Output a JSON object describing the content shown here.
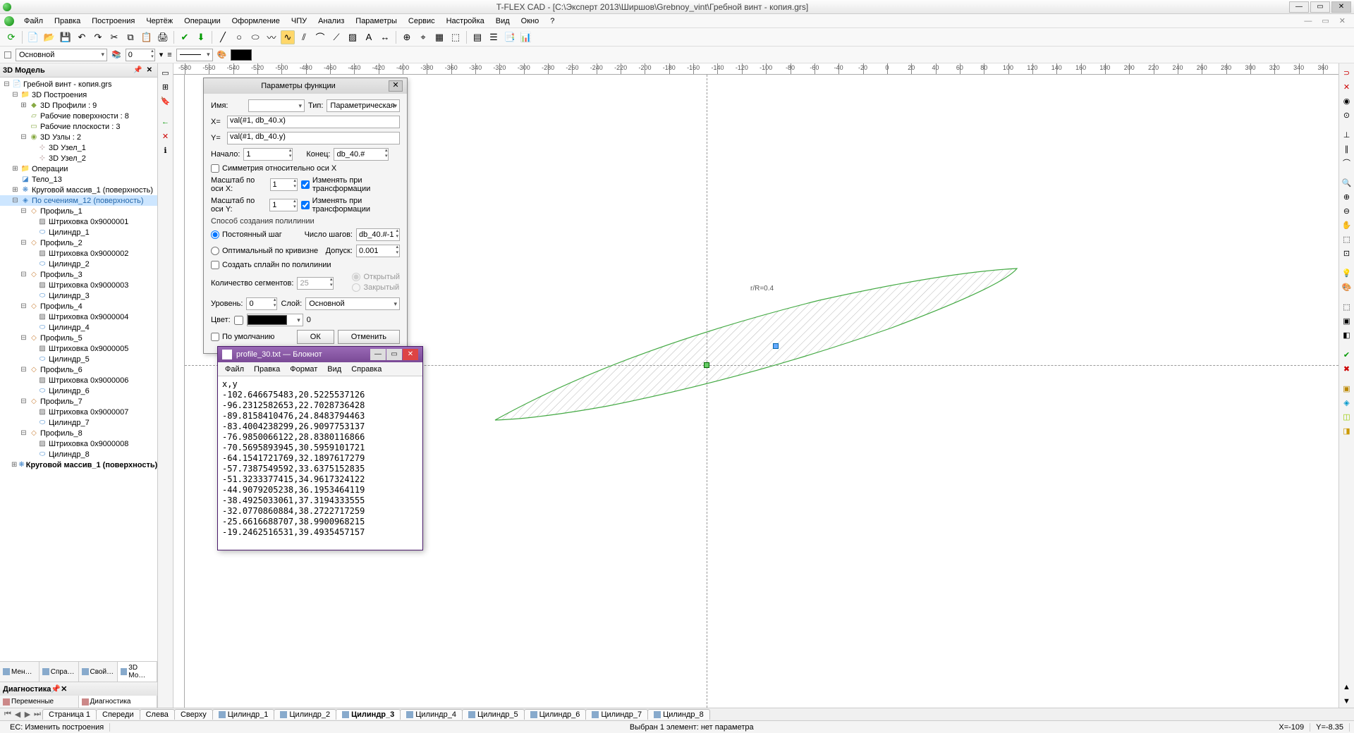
{
  "app": {
    "title": "T-FLEX CAD - [C:\\Эксперт 2013\\Ширшов\\Grebnoy_vint\\Гребной винт - копия.grs]"
  },
  "menu": [
    "Файл",
    "Правка",
    "Построения",
    "Чертёж",
    "Операции",
    "Оформление",
    "ЧПУ",
    "Анализ",
    "Параметры",
    "Сервис",
    "Настройка",
    "Вид",
    "Окно",
    "?"
  ],
  "props": {
    "layer": "Основной",
    "level": "0",
    "color_field": ""
  },
  "left_panel": {
    "title": "3D Модель",
    "root": "Гребной винт - копия.grs",
    "grp_3d": "3D Построения",
    "profiles": "3D Профили : 9",
    "surfaces": "Рабочие поверхности : 8",
    "planes": "Рабочие плоскости : 3",
    "nodes": "3D Узлы : 2",
    "node1": "3D Узел_1",
    "node2": "3D Узел_2",
    "ops": "Операции",
    "body": "Тело_13",
    "circ": "Круговой массив_1 (поверхность)",
    "loft": "По сечениям_12 (поверхность)",
    "p1": "Профиль_1",
    "h1": "Штриховка 0x9000001",
    "c1": "Цилиндр_1",
    "p2": "Профиль_2",
    "h2": "Штриховка 0x9000002",
    "c2": "Цилиндр_2",
    "p3": "Профиль_3",
    "h3": "Штриховка 0x9000003",
    "c3": "Цилиндр_3",
    "p4": "Профиль_4",
    "h4": "Штриховка 0x9000004",
    "c4": "Цилиндр_4",
    "p5": "Профиль_5",
    "h5": "Штриховка 0x9000005",
    "c5": "Цилиндр_5",
    "p6": "Профиль_6",
    "h6": "Штриховка 0x9000006",
    "c6": "Цилиндр_6",
    "p7": "Профиль_7",
    "h7": "Штриховка 0x9000007",
    "c7": "Цилиндр_7",
    "p8": "Профиль_8",
    "h8": "Штриховка 0x9000008",
    "c8": "Цилиндр_8",
    "circ2": "Круговой массив_1 (поверхность)"
  },
  "panel_tabs": [
    "Мен…",
    "Спра…",
    "Свой…",
    "3D Мо…"
  ],
  "diag": {
    "title": "Диагностика",
    "tabs": [
      "Переменные",
      "Диагностика"
    ]
  },
  "dialog": {
    "title": "Параметры функции",
    "name_lbl": "Имя:",
    "name_val": "",
    "type_lbl": "Тип:",
    "type_val": "Параметрическая",
    "x_lbl": "X=",
    "x_val": "val(#1, db_40.x)",
    "y_lbl": "Y=",
    "y_val": "val(#1, db_40.y)",
    "start_lbl": "Начало:",
    "start_val": "1",
    "end_lbl": "Конец:",
    "end_val": "db_40.#",
    "sym_lbl": "Симметрия относительно оси X",
    "sx_lbl": "Масштаб по оси X:",
    "sx_val": "1",
    "sy_lbl": "Масштаб по оси Y:",
    "sy_val": "1",
    "chg_lbl": "Изменять при трансформации",
    "poly_hdr": "Способ создания полилинии",
    "step_const": "Постоянный шаг",
    "step_opt": "Оптимальный по кривизне",
    "steps_lbl": "Число шагов:",
    "steps_val": "db_40.#-1",
    "tol_lbl": "Допуск:",
    "tol_val": "0.001",
    "spline_lbl": "Создать сплайн по полилинии",
    "seg_lbl": "Количество сегментов:",
    "seg_val": "25",
    "open_lbl": "Открытый",
    "closed_lbl": "Закрытый",
    "lvl_lbl": "Уровень:",
    "lvl_val": "0",
    "layer_lbl": "Слой:",
    "layer_val": "Основной",
    "color_lbl": "Цвет:",
    "color_num": "0",
    "default_lbl": "По умолчанию",
    "ok": "ОК",
    "cancel": "Отменить"
  },
  "notepad": {
    "title": "profile_30.txt — Блокнот",
    "menu": [
      "Файл",
      "Правка",
      "Формат",
      "Вид",
      "Справка"
    ],
    "header": "x,y",
    "lines": [
      "-102.646675483,20.5225537126",
      "-96.2312582653,22.7028736428",
      "-89.8158410476,24.8483794463",
      "-83.4004238299,26.9097753137",
      "-76.9850066122,28.8380116866",
      "-70.5695893945,30.5959101721",
      "-64.1541721769,32.1897617279",
      "-57.7387549592,33.6375152835",
      "-51.3233377415,34.9617324122",
      "-44.9079205238,36.1953464119",
      "-38.4925033061,37.3194333555",
      "-32.0770860884,38.2722717259",
      "-25.6616688707,38.9900968215",
      "-19.2462516531,39.4935457157"
    ]
  },
  "bottom_tabs": [
    "Страница 1",
    "Спереди",
    "Слева",
    "Сверху",
    "Цилиндр_1",
    "Цилиндр_2",
    "Цилиндр_3",
    "Цилиндр_4",
    "Цилиндр_5",
    "Цилиндр_6",
    "Цилиндр_7",
    "Цилиндр_8"
  ],
  "bottom_active_index": 6,
  "status": {
    "left": "ЕС: Изменить построения",
    "center": "Выбран 1 элемент: нет параметра",
    "x_lbl": "X=",
    "x_val": "-109",
    "y_lbl": "Y=",
    "y_val": "-8.35"
  },
  "canvas": {
    "label": "r/R=0.4"
  },
  "ruler_ticks": [
    "-580",
    "-560",
    "-540",
    "-520",
    "-500",
    "-480",
    "-460",
    "-440",
    "-420",
    "-400",
    "-380",
    "-360",
    "-340",
    "-320",
    "-300",
    "-280",
    "-260",
    "-240",
    "-220",
    "-200",
    "-180",
    "-160",
    "-140",
    "-120",
    "-100",
    "-80",
    "-60",
    "-40",
    "-20",
    "0",
    "20",
    "40",
    "60",
    "80",
    "100",
    "120",
    "140",
    "160",
    "180",
    "200",
    "220",
    "240",
    "260",
    "280",
    "300",
    "320",
    "340",
    "360"
  ]
}
